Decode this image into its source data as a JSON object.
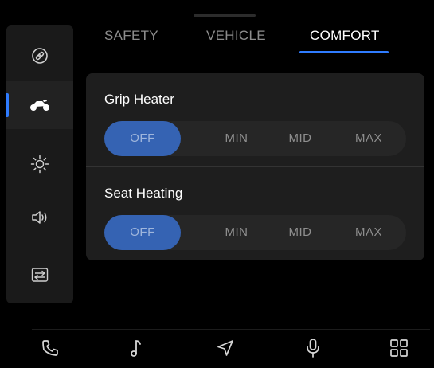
{
  "tabs": [
    {
      "label": "SAFETY",
      "active": false
    },
    {
      "label": "VEHICLE",
      "active": false
    },
    {
      "label": "COMFORT",
      "active": true
    }
  ],
  "sidebar": {
    "items": [
      {
        "icon": "link-icon",
        "active": false
      },
      {
        "icon": "motorcycle-icon",
        "active": true
      },
      {
        "icon": "brightness-icon",
        "active": false
      },
      {
        "icon": "volume-icon",
        "active": false
      },
      {
        "icon": "settings-toggle-icon",
        "active": false
      }
    ]
  },
  "settings": {
    "grip_heater": {
      "label": "Grip Heater",
      "options": [
        "OFF",
        "MIN",
        "MID",
        "MAX"
      ],
      "selected": "OFF"
    },
    "seat_heating": {
      "label": "Seat Heating",
      "options": [
        "OFF",
        "MIN",
        "MID",
        "MAX"
      ],
      "selected": "OFF"
    }
  },
  "bottom_bar": {
    "items": [
      "phone-icon",
      "music-icon",
      "navigation-icon",
      "microphone-icon",
      "apps-grid-icon"
    ]
  },
  "colors": {
    "accent": "#2f7cff",
    "selected_segment": "#3563b3",
    "background": "#000000",
    "panel": "#1e1e1e"
  }
}
